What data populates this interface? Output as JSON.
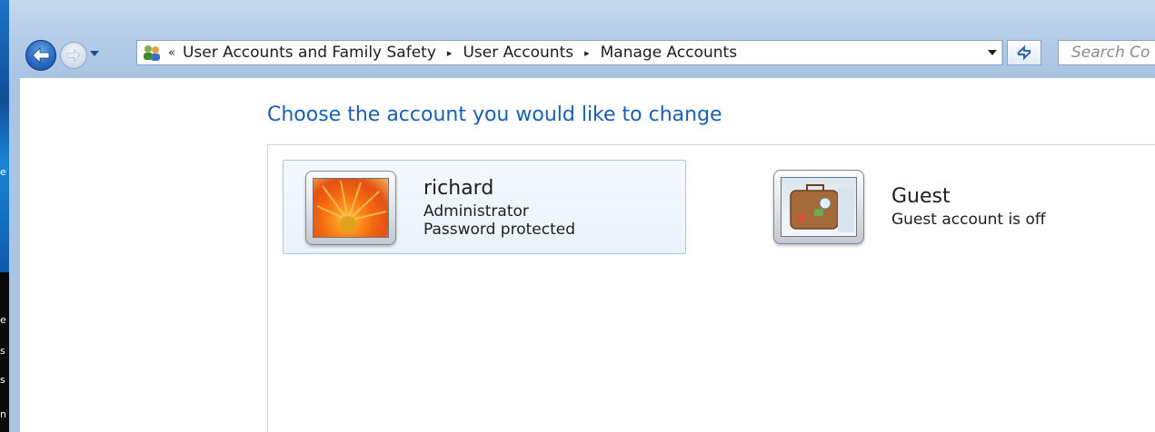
{
  "navigation": {
    "back_icon": "back-arrow-icon",
    "forward_icon": "forward-arrow-icon",
    "history_icon": "chevron-down-icon"
  },
  "address_bar": {
    "icon": "user-accounts-icon",
    "overflow_chevron": "«",
    "breadcrumbs": [
      "User Accounts and Family Safety",
      "User Accounts",
      "Manage Accounts"
    ],
    "separator": "▸",
    "dropdown_icon": "chevron-down-icon"
  },
  "refresh": {
    "icon": "refresh-icon"
  },
  "search": {
    "placeholder": "Search Co"
  },
  "page": {
    "title": "Choose the account you would like to change"
  },
  "accounts": [
    {
      "name": "richard",
      "line1": "Administrator",
      "line2": "Password protected",
      "picture": "orange-flower-picture",
      "selected": true
    },
    {
      "name": "Guest",
      "line1": "Guest account is off",
      "line2": "",
      "picture": "suitcase-picture",
      "selected": false
    }
  ],
  "colors": {
    "title_blue": "#1a5fb4",
    "selection_border": "#a9c6ea",
    "selection_fill": "#eaf2fc",
    "frame_blue": "#b4cde9"
  }
}
